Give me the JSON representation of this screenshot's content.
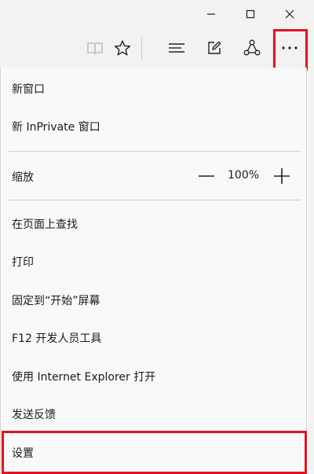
{
  "window": {
    "icons": [
      "minimize-icon",
      "maximize-icon",
      "close-icon"
    ]
  },
  "toolbar": {
    "icons": [
      "reading-view-icon",
      "favorites-star-icon",
      "hub-icon",
      "web-note-icon",
      "share-icon",
      "more-actions-icon"
    ]
  },
  "menu": {
    "new_window": "新窗口",
    "new_inprivate": "新 InPrivate 窗口",
    "zoom_label": "缩放",
    "zoom_value": "100%",
    "find_on_page": "在页面上查找",
    "print": "打印",
    "pin_to_start": "固定到“开始”屏幕",
    "f12_tools": "F12 开发人员工具",
    "open_with_ie": "使用 Internet Explorer 打开",
    "send_feedback": "发送反馈",
    "settings": "设置"
  },
  "colors": {
    "highlight": "#e0141e",
    "chrome_bg": "#f2f2f2",
    "menu_bg": "#f9f9f9"
  }
}
